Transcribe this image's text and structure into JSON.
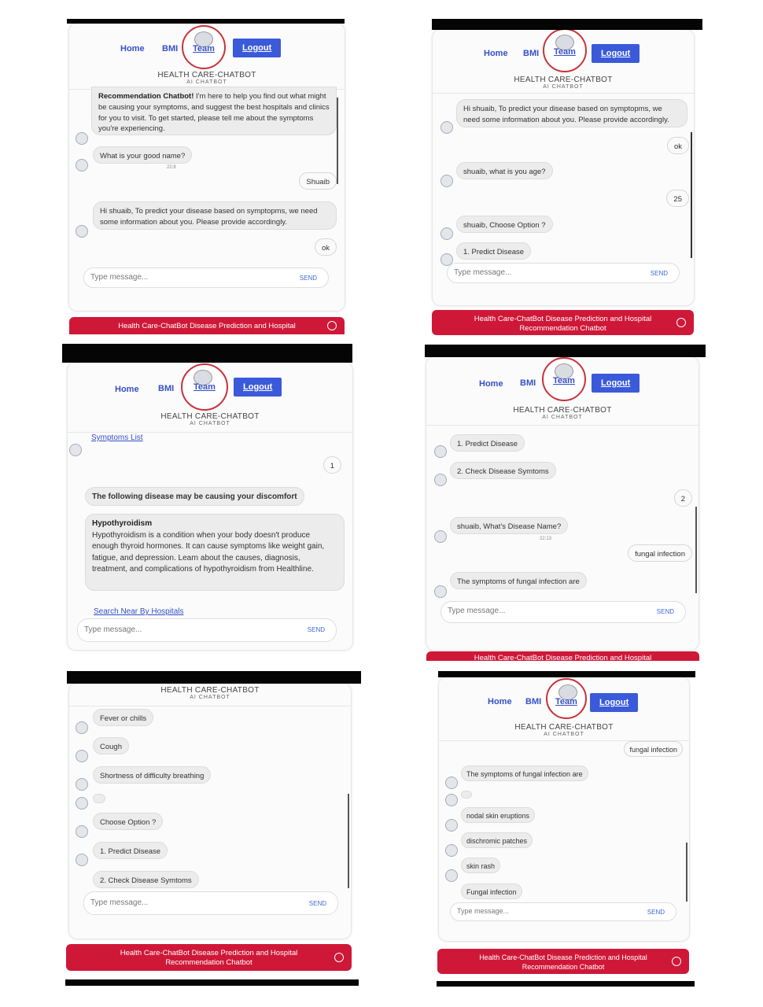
{
  "nav": {
    "home": "Home",
    "bmi": "BMI",
    "team": "Team",
    "logout": "Logout"
  },
  "brand": {
    "title": "HEALTH CARE-CHATBOT",
    "subtitle": "AI CHATBOT"
  },
  "input": {
    "placeholder": "Type message...",
    "send": "SEND"
  },
  "footer": {
    "line1": "Health Care-ChatBot Disease Prediction and Hospital",
    "line2": "Recommendation Chatbot"
  },
  "panel1": {
    "intro_bold": "Recommendation Chatbot!",
    "intro_rest": " I'm here to help you find out what might be causing your symptoms, and suggest the best hospitals and clinics for you to visit. To get started, please tell me about the symptoms you're experiencing.",
    "ask_name": "What is your good name?",
    "ask_name_time": "22:8",
    "user_name": "Shuaib",
    "info": "Hi shuaib, To predict your disease based on symptopms, we need some information about you. Please provide accordingly.",
    "user_ok": "ok"
  },
  "panel2": {
    "info": "Hi shuaib, To predict your disease based on symptopms, we need some information about you. Please provide accordingly.",
    "user_ok": "ok",
    "ask_age": "shuaib, what is you age?",
    "user_age": "25",
    "choose": "shuaib, Choose Option ?",
    "option1": "1. Predict Disease"
  },
  "panel3": {
    "symptoms_link": "Symptoms List",
    "user_1": "1",
    "following": "The following disease may be causing your discomfort",
    "disease_name": "Hypothyroidism",
    "disease_desc": "Hypothyroidism is a condition when your body doesn't produce enough thyroid hormones. It can cause symptoms like weight gain, fatigue, and depression. Learn about the causes, diagnosis, treatment, and complications of hypothyroidism from Healthline.",
    "hospitals_link": "Search Near By Hospitals"
  },
  "panel4": {
    "option1": "1. Predict Disease",
    "option2": "2. Check Disease Symtoms",
    "user_2": "2",
    "ask_disease": "shuaib, What's Disease Name?",
    "ask_time": "22:13",
    "user_disease": "fungal infection",
    "symptoms_of": "The symptoms of fungal infection are"
  },
  "panel5": {
    "s1": "Fever or chills",
    "s2": "Cough",
    "s3": "Shortness of difficulty breathing",
    "choose": "Choose Option ?",
    "option1": "1. Predict Disease",
    "option2": "2. Check Disease Symtoms"
  },
  "panel6": {
    "user_disease": "fungal infection",
    "symptoms_of": "The symptoms of fungal infection are",
    "s1": "nodal skin eruptions",
    "s2": "dischromic patches",
    "s3": "skin rash",
    "s4": "Fungal infection"
  }
}
